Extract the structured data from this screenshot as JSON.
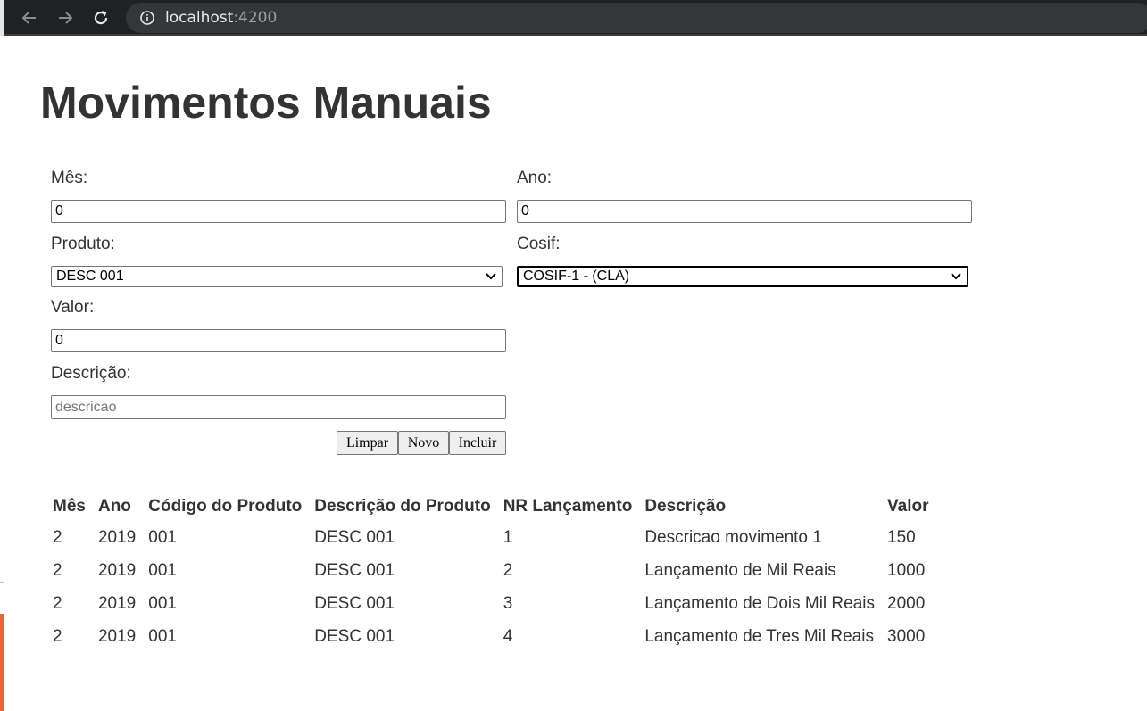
{
  "browser": {
    "url_host": "localhost",
    "url_port": ":4200"
  },
  "page": {
    "title": "Movimentos Manuais"
  },
  "form": {
    "mes_label": "Mês:",
    "mes_value": "0",
    "ano_label": "Ano:",
    "ano_value": "0",
    "produto_label": "Produto:",
    "produto_selected": "DESC 001",
    "cosif_label": "Cosif:",
    "cosif_selected": "COSIF-1 - (CLA)",
    "valor_label": "Valor:",
    "valor_value": "0",
    "descricao_label": "Descrição:",
    "descricao_placeholder": "descricao",
    "buttons": {
      "limpar": "Limpar",
      "novo": "Novo",
      "incluir": "Incluir"
    }
  },
  "table": {
    "headers": [
      "Mês",
      "Ano",
      "Código do Produto",
      "Descrição do Produto",
      "NR Lançamento",
      "Descrição",
      "Valor"
    ],
    "rows": [
      [
        "2",
        "2019",
        "001",
        "DESC 001",
        "1",
        "Descricao movimento 1",
        "150"
      ],
      [
        "2",
        "2019",
        "001",
        "DESC 001",
        "2",
        "Lançamento de Mil Reais",
        "1000"
      ],
      [
        "2",
        "2019",
        "001",
        "DESC 001",
        "3",
        "Lançamento de Dois Mil Reais",
        "2000"
      ],
      [
        "2",
        "2019",
        "001",
        "DESC 001",
        "4",
        "Lançamento de Tres Mil Reais",
        "3000"
      ]
    ]
  }
}
